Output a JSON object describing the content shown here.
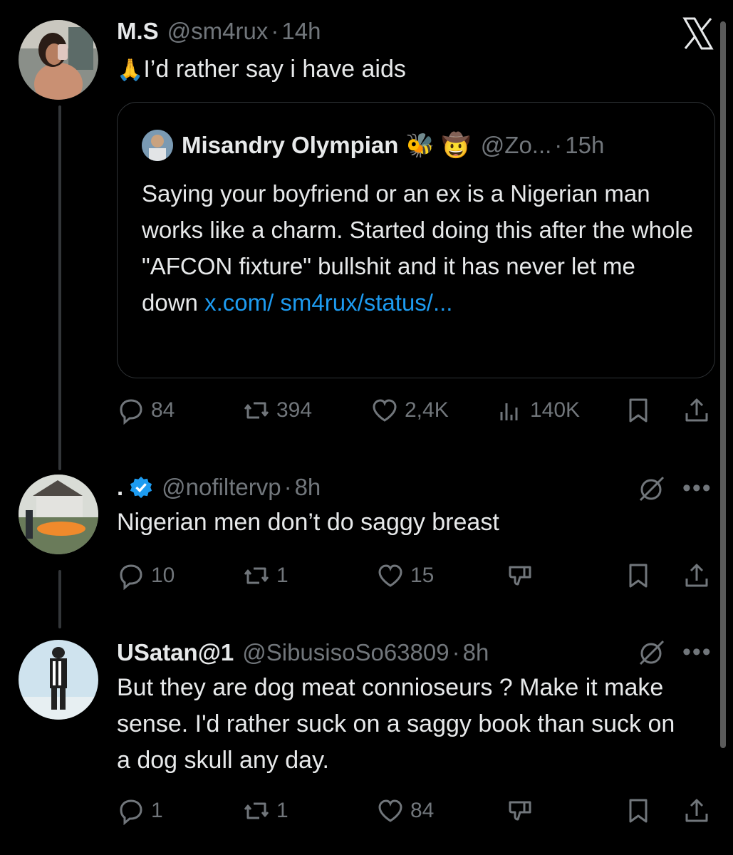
{
  "close_glyph": "X",
  "tweets": [
    {
      "name": "M.S",
      "handle": "@sm4rux",
      "dot": "·",
      "time": "14h",
      "emoji": "🙏",
      "text": "I’d rather say i have aids",
      "quote": {
        "name": "Misandry Olympian",
        "emoji": "🐝 🤠",
        "handle": "@Zo...",
        "dot": "·",
        "time": "15h",
        "text": "Saying your boyfriend or an ex is a Nigerian man works like a charm. Started doing this after the whole \"AFCON fixture\" bullshit and it has never let me down ",
        "link": "x.com/ sm4rux/status/..."
      },
      "stats": {
        "replies": "84",
        "reposts": "394",
        "likes": "2,4K",
        "views": "140K"
      }
    },
    {
      "name": ".",
      "handle": "@nofiltervp",
      "dot": "·",
      "time": "8h",
      "text": "Nigerian men don’t do saggy breast",
      "stats": {
        "replies": "10",
        "reposts": "1",
        "likes": "15"
      }
    },
    {
      "name": "USatan@1",
      "handle": "@SibusisoSo63809",
      "dot": "·",
      "time": "8h",
      "text": "But they are dog meat connioseurs ? Make it make sense. I'd rather suck on a saggy book than suck on a dog skull any day.",
      "stats": {
        "replies": "1",
        "reposts": "1",
        "likes": "84"
      }
    }
  ],
  "more_glyph": "•••",
  "colors": {
    "background": "#000000",
    "text": "#e7e9ea",
    "muted": "#71767b",
    "link": "#1d9bf0",
    "verified": "#1d9bf0",
    "border": "#2f3336"
  }
}
